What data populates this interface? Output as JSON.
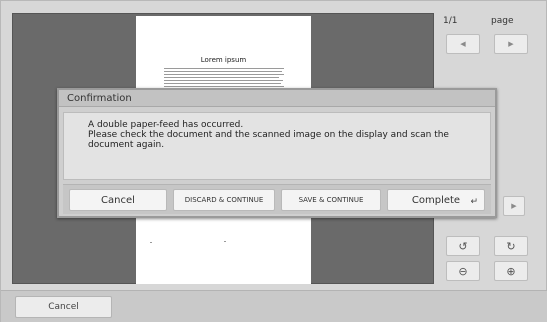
{
  "page_info": {
    "counter": "1/1",
    "label": "page"
  },
  "nav": {
    "prev": "◀",
    "next": "▶",
    "next_row2": "▶"
  },
  "tools": {
    "rotate_left": "↺",
    "rotate_right": "↻",
    "zoom_out": "⊖",
    "zoom_in": "⊕"
  },
  "preview": {
    "doc_title": "Lorem ipsum"
  },
  "dialog": {
    "title": "Confirmation",
    "message_line1": "A double paper-feed has occurred.",
    "message_line2": "Please check the document and the scanned image on the display and scan the",
    "message_line3": "document again.",
    "buttons": {
      "cancel": "Cancel",
      "discard": "DISCARD & CONTINUE",
      "save": "SAVE & CONTINUE",
      "complete": "Complete",
      "complete_icon": "↵"
    }
  },
  "bottom": {
    "cancel": "Cancel"
  }
}
